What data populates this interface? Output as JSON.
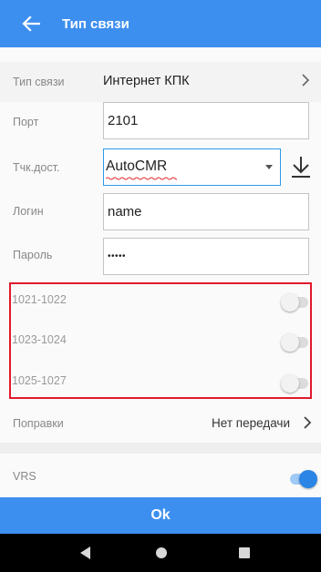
{
  "app_bar": {
    "title": "Тип связи",
    "back_icon": "arrow-left-icon",
    "color": "#3d8fef"
  },
  "connection_type": {
    "label": "Тип связи",
    "value": "Интернет КПК",
    "chevron_icon": "chevron-right-icon"
  },
  "port": {
    "label": "Порт",
    "value": "2101"
  },
  "access_point": {
    "label": "Тчк.дост.",
    "value": "AutoCMR",
    "dropdown_icon": "caret-down-icon",
    "download_icon": "download-icon"
  },
  "login": {
    "label": "Логин",
    "value": "name"
  },
  "password": {
    "label": "Пароль",
    "value": "•••••"
  },
  "toggles": [
    {
      "label": "1021-1022",
      "on": false
    },
    {
      "label": "1023-1024",
      "on": false
    },
    {
      "label": "1025-1027",
      "on": false
    }
  ],
  "corrections": {
    "label": "Поправки",
    "value": "Нет передачи",
    "chevron_icon": "chevron-right-icon"
  },
  "vrs": {
    "label": "VRS",
    "on": true
  },
  "ok_button": {
    "label": "Ok"
  },
  "nav_bar": {
    "back_icon": "nav-back-icon",
    "home_icon": "nav-home-icon",
    "recents_icon": "nav-recents-icon"
  },
  "colors": {
    "accent": "#3d8fef",
    "highlight_border": "#e0192b",
    "toggle_on": "#2a85e6"
  }
}
